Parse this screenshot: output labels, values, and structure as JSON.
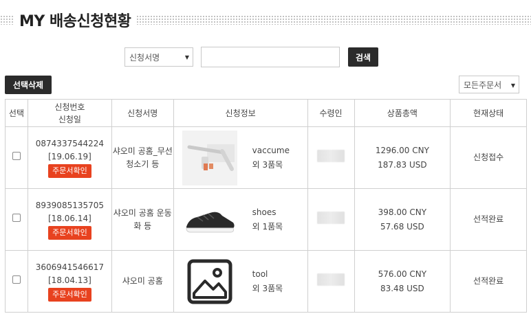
{
  "header": {
    "title": "MY 배송신청현황"
  },
  "search": {
    "field_label": "신청서명",
    "input_value": "",
    "button_label": "검색"
  },
  "toolbar": {
    "delete_label": "선택삭제",
    "filter_label": "모든주문서"
  },
  "table": {
    "headers": {
      "select": "선택",
      "no_line1": "신청번호",
      "no_line2": "신청일",
      "form": "신청서명",
      "info": "신청정보",
      "receiver": "수령인",
      "total": "상품총액",
      "status": "현재상태"
    },
    "rows": [
      {
        "number": "0874337544224",
        "date": "[19.06.19]",
        "order_btn": "주문서확인",
        "form_name": "샤오미 공홈_무선청소기 등",
        "item_name": "vaccume",
        "item_count": "외 3품목",
        "thumb_icon": "vacuum-product-icon",
        "amount_cny": "1296.00 CNY",
        "amount_usd": "187.83 USD",
        "status": "신청접수"
      },
      {
        "number": "8939085135705",
        "date": "[18.06.14]",
        "order_btn": "주문서확인",
        "form_name": "샤오미 공홈 운동화 등",
        "item_name": "shoes",
        "item_count": "외 1품목",
        "thumb_icon": "sneaker-product-icon",
        "amount_cny": "398.00 CNY",
        "amount_usd": "57.68 USD",
        "status": "선적완료"
      },
      {
        "number": "3606941546617",
        "date": "[18.04.13]",
        "order_btn": "주문서확인",
        "form_name": "샤오미 공홈",
        "item_name": "tool",
        "item_count": "외 3품목",
        "thumb_icon": "image-placeholder-icon",
        "amount_cny": "576.00 CNY",
        "amount_usd": "83.48 USD",
        "status": "선적완료"
      }
    ]
  },
  "colors": {
    "accent": "#e8421f",
    "dark_button": "#2b2b2b",
    "border": "#cfcfcf"
  }
}
